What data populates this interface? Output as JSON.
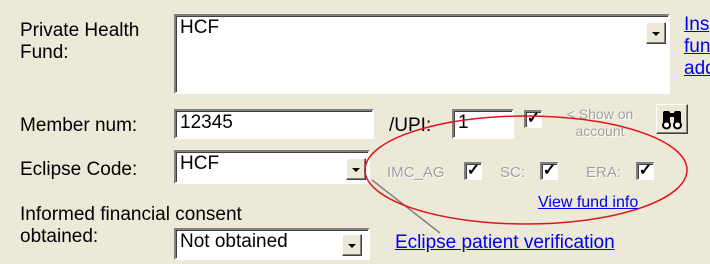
{
  "fund": {
    "label": "Private Health Fund:",
    "value": "HCF",
    "side_link": "Ins fun add"
  },
  "member": {
    "label": "Member num:",
    "value": "12345",
    "upi_label": "/UPI:",
    "upi_value": "1",
    "show_on_account_label": "< Show on account",
    "show_on_account_checked": true,
    "search_icon": "binoculars-icon"
  },
  "eclipse": {
    "label": "Eclipse Code:",
    "value": "HCF",
    "flags": [
      {
        "label": "IMC_AG",
        "checked": true
      },
      {
        "label": "SC:",
        "checked": true
      },
      {
        "label": "ERA:",
        "checked": true
      }
    ],
    "view_fund_info": "View fund info",
    "verification_link": "Eclipse patient verification"
  },
  "consent": {
    "label": "Informed financial consent obtained:",
    "value": "Not obtained"
  },
  "annotation_color": "#e0141e"
}
